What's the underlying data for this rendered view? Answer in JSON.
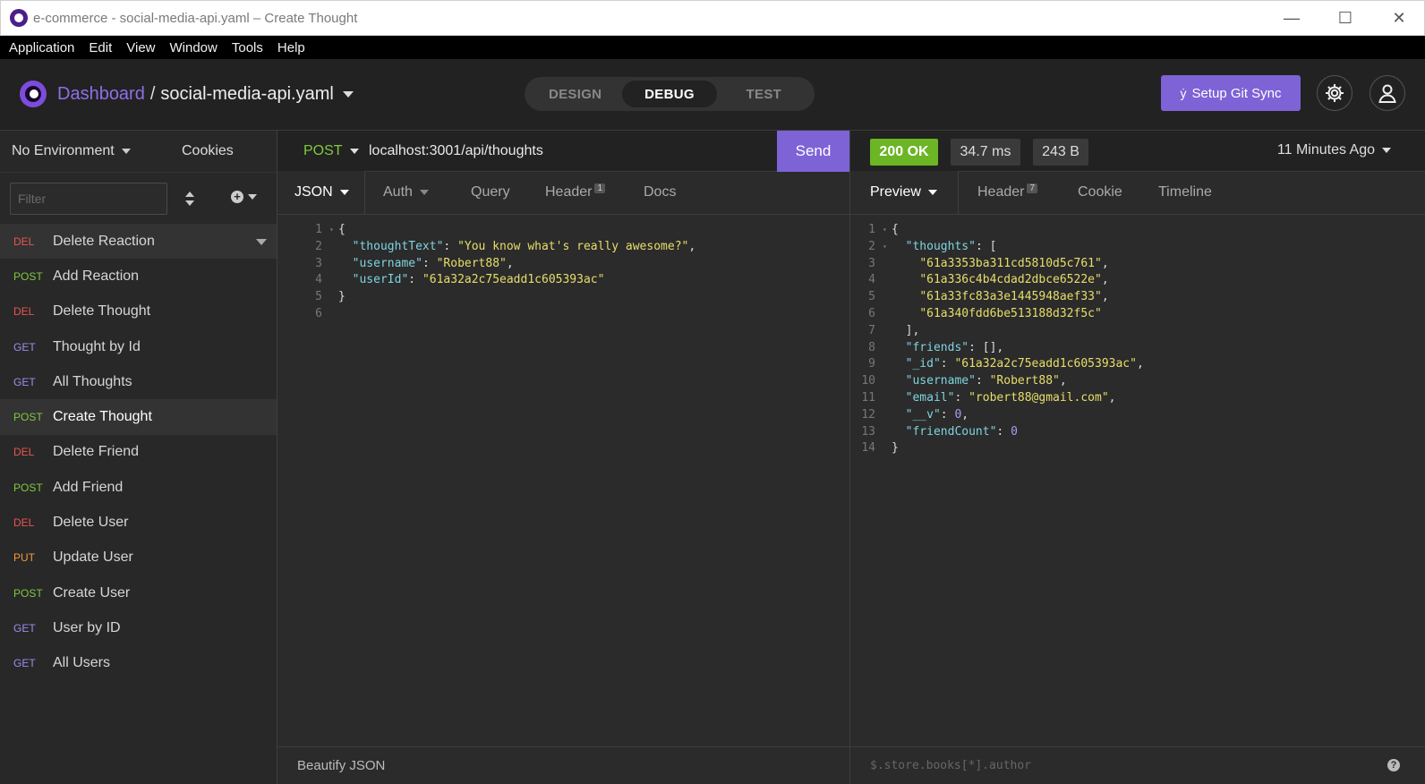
{
  "window": {
    "title": "e-commerce - social-media-api.yaml – Create Thought"
  },
  "menu": [
    "Application",
    "Edit",
    "View",
    "Window",
    "Tools",
    "Help"
  ],
  "header": {
    "dashboard": "Dashboard",
    "separator": "/",
    "file": "social-media-api.yaml",
    "modes": [
      "DESIGN",
      "DEBUG",
      "TEST"
    ],
    "active_mode": "DEBUG",
    "git_button": "Setup Git Sync"
  },
  "sidebar": {
    "environment": "No Environment",
    "cookies": "Cookies",
    "filter_placeholder": "Filter",
    "requests": [
      {
        "method": "DEL",
        "name": "Delete Reaction"
      },
      {
        "method": "POST",
        "name": "Add Reaction"
      },
      {
        "method": "DEL",
        "name": "Delete Thought"
      },
      {
        "method": "GET",
        "name": "Thought by Id"
      },
      {
        "method": "GET",
        "name": "All Thoughts"
      },
      {
        "method": "POST",
        "name": "Create Thought"
      },
      {
        "method": "DEL",
        "name": "Delete Friend"
      },
      {
        "method": "POST",
        "name": "Add Friend"
      },
      {
        "method": "DEL",
        "name": "Delete User"
      },
      {
        "method": "PUT",
        "name": "Update User"
      },
      {
        "method": "POST",
        "name": "Create User"
      },
      {
        "method": "GET",
        "name": "User by ID"
      },
      {
        "method": "GET",
        "name": "All Users"
      }
    ]
  },
  "method_colors": {
    "DEL": "#e8554e",
    "POST": "#7fc940",
    "GET": "#9d8cf0",
    "PUT": "#f09a3c"
  },
  "request": {
    "method": "POST",
    "url": "localhost:3001/api/thoughts",
    "send": "Send",
    "tabs": {
      "body": "JSON",
      "auth": "Auth",
      "query": "Query",
      "header": "Header",
      "header_count": "1",
      "docs": "Docs"
    },
    "body_lines": [
      [
        [
          "p",
          "{"
        ]
      ],
      [
        [
          "p",
          "  "
        ],
        [
          "k",
          "\"thoughtText\""
        ],
        [
          "p",
          ": "
        ],
        [
          "s",
          "\"You know what's really awesome?\""
        ],
        [
          "p",
          ","
        ]
      ],
      [
        [
          "p",
          "  "
        ],
        [
          "k",
          "\"username\""
        ],
        [
          "p",
          ": "
        ],
        [
          "s",
          "\"Robert88\""
        ],
        [
          "p",
          ","
        ]
      ],
      [
        [
          "p",
          "  "
        ],
        [
          "k",
          "\"userId\""
        ],
        [
          "p",
          ": "
        ],
        [
          "s",
          "\"61a32a2c75eadd1c605393ac\""
        ]
      ],
      [
        [
          "p",
          "}"
        ]
      ],
      [
        [
          "p",
          ""
        ]
      ]
    ],
    "footer": "Beautify JSON"
  },
  "response": {
    "status": "200 OK",
    "time": "34.7 ms",
    "size": "243 B",
    "ago": "11 Minutes Ago",
    "tabs": {
      "preview": "Preview",
      "header": "Header",
      "header_count": "7",
      "cookie": "Cookie",
      "timeline": "Timeline"
    },
    "body_lines": [
      [
        [
          "p",
          "{"
        ]
      ],
      [
        [
          "p",
          "  "
        ],
        [
          "k",
          "\"thoughts\""
        ],
        [
          "p",
          ": ["
        ]
      ],
      [
        [
          "p",
          "    "
        ],
        [
          "s",
          "\"61a3353ba311cd5810d5c761\""
        ],
        [
          "p",
          ","
        ]
      ],
      [
        [
          "p",
          "    "
        ],
        [
          "s",
          "\"61a336c4b4cdad2dbce6522e\""
        ],
        [
          "p",
          ","
        ]
      ],
      [
        [
          "p",
          "    "
        ],
        [
          "s",
          "\"61a33fc83a3e1445948aef33\""
        ],
        [
          "p",
          ","
        ]
      ],
      [
        [
          "p",
          "    "
        ],
        [
          "s",
          "\"61a340fdd6be513188d32f5c\""
        ]
      ],
      [
        [
          "p",
          "  ],"
        ]
      ],
      [
        [
          "p",
          "  "
        ],
        [
          "k",
          "\"friends\""
        ],
        [
          "p",
          ": [],"
        ]
      ],
      [
        [
          "p",
          "  "
        ],
        [
          "k",
          "\"_id\""
        ],
        [
          "p",
          ": "
        ],
        [
          "s",
          "\"61a32a2c75eadd1c605393ac\""
        ],
        [
          "p",
          ","
        ]
      ],
      [
        [
          "p",
          "  "
        ],
        [
          "k",
          "\"username\""
        ],
        [
          "p",
          ": "
        ],
        [
          "s",
          "\"Robert88\""
        ],
        [
          "p",
          ","
        ]
      ],
      [
        [
          "p",
          "  "
        ],
        [
          "k",
          "\"email\""
        ],
        [
          "p",
          ": "
        ],
        [
          "s",
          "\"robert88@gmail.com\""
        ],
        [
          "p",
          ","
        ]
      ],
      [
        [
          "p",
          "  "
        ],
        [
          "k",
          "\"__v\""
        ],
        [
          "p",
          ": "
        ],
        [
          "num",
          "0"
        ],
        [
          "p",
          ","
        ]
      ],
      [
        [
          "p",
          "  "
        ],
        [
          "k",
          "\"friendCount\""
        ],
        [
          "p",
          ": "
        ],
        [
          "num",
          "0"
        ]
      ],
      [
        [
          "p",
          "}"
        ]
      ]
    ],
    "filter_placeholder": "$.store.books[*].author"
  }
}
